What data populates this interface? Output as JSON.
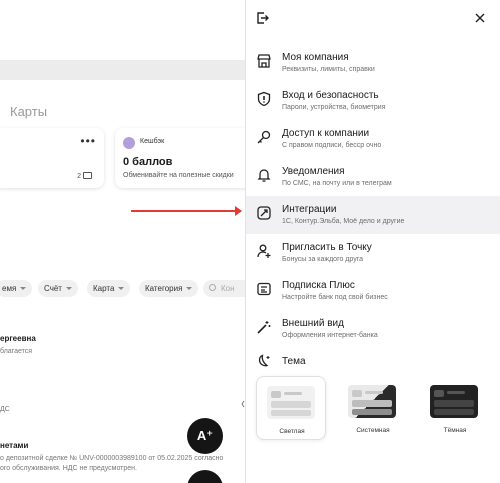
{
  "background": {
    "tab_label": "Карты",
    "card_menu": "•••",
    "card_count": "2",
    "cashback": {
      "label": "Кешбэк",
      "title": "0 баллов",
      "subtitle": "Обменивайте на полезные скидки"
    },
    "filters": [
      "емя",
      "Счёт",
      "Карта",
      "Категория"
    ],
    "search_placeholder": "Кон",
    "rows": [
      {
        "title": "ергеевна",
        "subtitle": "благается"
      },
      {
        "title": "",
        "subtitle": "ДС"
      },
      {
        "title": "нетами",
        "subtitle": "о депозитной сделке № UNV-0000003989100 от 05.02.2025 согласно"
      },
      {
        "title": "",
        "subtitle": "ого обслуживания. НДС не предусмотрен."
      }
    ],
    "fab_label": "A⁺",
    "accent_color": "#e53935"
  },
  "panel": {
    "menu": [
      {
        "icon": "shop-icon",
        "title": "Моя компания",
        "subtitle": "Реквизиты, лимиты, справки"
      },
      {
        "icon": "shield-icon",
        "title": "Вход и безопасность",
        "subtitle": "Пароли, устройства, биометрия"
      },
      {
        "icon": "key-icon",
        "title": "Доступ к компании",
        "subtitle": "С правом подписи, бесср очно"
      },
      {
        "icon": "bell-icon",
        "title": "Уведомления",
        "subtitle": "По СМС, на почту или в телеграм"
      },
      {
        "icon": "integrations-icon",
        "title": "Интеграции",
        "subtitle": "1С, Контур.Эльба, Моё дело и другие"
      },
      {
        "icon": "invite-icon",
        "title": "Пригласить в Точку",
        "subtitle": "Бонусы за каждого друга"
      },
      {
        "icon": "subscription-icon",
        "title": "Подписка Плюс",
        "subtitle": "Настройте банк под свой бизнес"
      },
      {
        "icon": "magic-wand-icon",
        "title": "Внешний вид",
        "subtitle": "Оформления интернет-банка"
      }
    ],
    "theme": {
      "title": "Тема",
      "options": [
        {
          "label": "Светлая",
          "selected": true
        },
        {
          "label": "Системная",
          "selected": false
        },
        {
          "label": "Тёмная",
          "selected": false
        }
      ]
    },
    "active_item": "Интеграции"
  }
}
